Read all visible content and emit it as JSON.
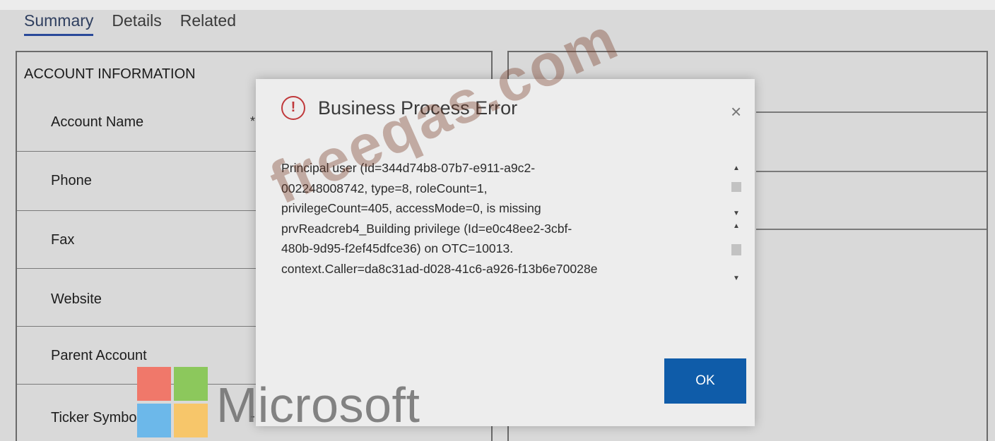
{
  "tabs": [
    {
      "label": "Summary",
      "active": true
    },
    {
      "label": "Details",
      "active": false
    },
    {
      "label": "Related",
      "active": false
    }
  ],
  "account_section": {
    "title": "ACCOUNT INFORMATION",
    "fields": [
      {
        "label": "Account Name",
        "indicator": "*"
      },
      {
        "label": "Phone",
        "indicator": ""
      },
      {
        "label": "Fax",
        "indicator": ""
      },
      {
        "label": "Website",
        "indicator": ""
      },
      {
        "label": "Parent Account",
        "indicator": ""
      },
      {
        "label": "Ticker Symbol",
        "indicator": "-"
      }
    ]
  },
  "dialog": {
    "title": "Business Process Error",
    "close_symbol": "×",
    "icon": "error-icon",
    "icon_symbol": "!",
    "message_lines": [
      "Principal user (Id=344d74b8-07b7-e911-a9c2-",
      "002248008742, type=8, roleCount=1,",
      "privilegeCount=405, accessMode=0, is missing",
      "prvReadcreb4_Building privilege (Id=e0c48ee2-3cbf-",
      "480b-9d95-f2ef45dfce36) on OTC=10013.",
      "context.Caller=da8c31ad-d028-41c6-a926-f13b6e70028e"
    ],
    "ok_label": "OK"
  },
  "watermark": {
    "text": "freeqas.com"
  },
  "logo": {
    "text": "Microsoft",
    "colors": [
      "#f25022",
      "#7fba00",
      "#00a4ef",
      "#ffb900"
    ]
  },
  "colors": {
    "ok_button": "#0f5ca9",
    "error_icon": "#c0393b",
    "active_tab": "#2a4a9a"
  }
}
